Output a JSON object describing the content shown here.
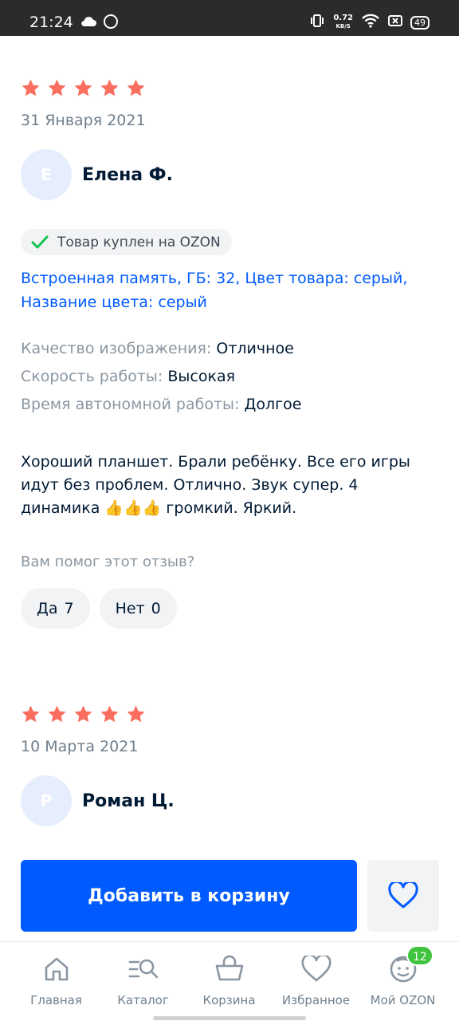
{
  "status_bar": {
    "time": "21:24",
    "net_speed_value": "0.72",
    "net_speed_unit": "KB/S",
    "battery": "49"
  },
  "reviews": [
    {
      "rating": 5,
      "date": "31 Января 2021",
      "avatar_letter": "Е",
      "author": "Елена Ф.",
      "badge": "Товар куплен на OZON",
      "variant": "Встроенная память, ГБ: 32, Цвет товара: серый, Название цвета: серый",
      "params": [
        {
          "key": "Качество изображения:",
          "value": "Отличное"
        },
        {
          "key": "Скорость работы:",
          "value": "Высокая"
        },
        {
          "key": "Время автономной работы:",
          "value": "Долгое"
        }
      ],
      "text": "Хороший планшет. Брали ребёнку. Все его игры идут без проблем. Отлично. Звук супер. 4 динамика 👍👍👍 громкий. Яркий.",
      "helpful_question": "Вам помог этот отзыв?",
      "yes_label": "Да",
      "yes_count": "7",
      "no_label": "Нет",
      "no_count": "0"
    },
    {
      "rating": 5,
      "date": "10 Марта 2021",
      "avatar_letter": "Р",
      "author": "Роман Ц."
    }
  ],
  "actions": {
    "add_to_cart": "Добавить в корзину",
    "favorite_icon": "heart-icon"
  },
  "colors": {
    "accent": "#005bff",
    "star": "#f96e5f",
    "badge_green": "#3fc43d",
    "check_green": "#10c44c"
  },
  "tabbar": {
    "items": [
      {
        "label": "Главная",
        "icon": "home-icon"
      },
      {
        "label": "Каталог",
        "icon": "catalog-icon"
      },
      {
        "label": "Корзина",
        "icon": "cart-icon"
      },
      {
        "label": "Избранное",
        "icon": "heart-icon"
      },
      {
        "label": "Мой OZON",
        "icon": "profile-icon",
        "badge": "12"
      }
    ]
  }
}
